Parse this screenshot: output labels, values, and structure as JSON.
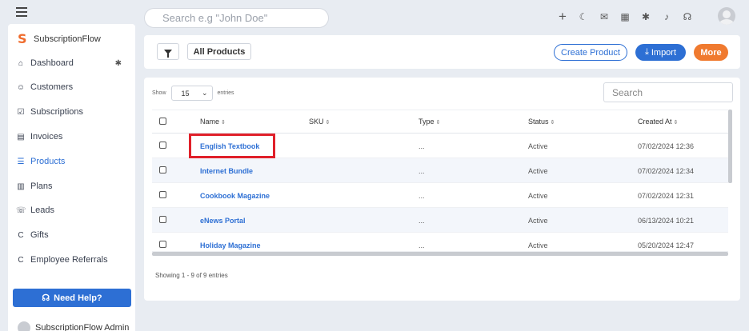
{
  "topbar": {
    "search_placeholder": "Search e.g \"John Doe\"",
    "icons": [
      "plus-icon",
      "moon-icon",
      "mail-icon",
      "calendar-icon",
      "gear-icon",
      "bell-icon",
      "headset-icon"
    ]
  },
  "sidebar": {
    "brand": "SubscriptionFlow",
    "items": [
      {
        "label": "Dashboard",
        "icon": "home-icon"
      },
      {
        "label": "Customers",
        "icon": "users-icon"
      },
      {
        "label": "Subscriptions",
        "icon": "calendar-check-icon"
      },
      {
        "label": "Invoices",
        "icon": "invoice-icon"
      },
      {
        "label": "Products",
        "icon": "list-icon"
      },
      {
        "label": "Plans",
        "icon": "columns-icon"
      },
      {
        "label": "Leads",
        "icon": "leads-icon"
      },
      {
        "label": "Gifts",
        "icon": "gift-icon"
      },
      {
        "label": "Employee Referrals",
        "icon": "referral-icon"
      }
    ],
    "help_label": "Need Help?",
    "user_name": "SubscriptionFlow Admin"
  },
  "toolbar": {
    "all_products": "All Products",
    "create_product": "Create Product",
    "import": "Import",
    "more": "More"
  },
  "table": {
    "show_label": "Show",
    "entries_value": "15",
    "entries_label": "entries",
    "search_placeholder": "Search",
    "columns": [
      "Name",
      "SKU",
      "Type",
      "Status",
      "Created At"
    ],
    "rows": [
      {
        "name": "English Textbook",
        "sku": "",
        "type": "...",
        "status": "Active",
        "created": "07/02/2024 12:36"
      },
      {
        "name": "Internet Bundle",
        "sku": "",
        "type": "...",
        "status": "Active",
        "created": "07/02/2024 12:34"
      },
      {
        "name": "Cookbook Magazine",
        "sku": "",
        "type": "...",
        "status": "Active",
        "created": "07/02/2024 12:31"
      },
      {
        "name": "eNews Portal",
        "sku": "",
        "type": "...",
        "status": "Active",
        "created": "06/13/2024 10:21"
      },
      {
        "name": "Holiday Magazine",
        "sku": "",
        "type": "...",
        "status": "Active",
        "created": "05/20/2024 12:47"
      }
    ],
    "info": "Showing 1 - 9 of 9 entries"
  },
  "colors": {
    "accent": "#2d6fd4",
    "more": "#f07a2f",
    "highlight": "#e0202a"
  }
}
